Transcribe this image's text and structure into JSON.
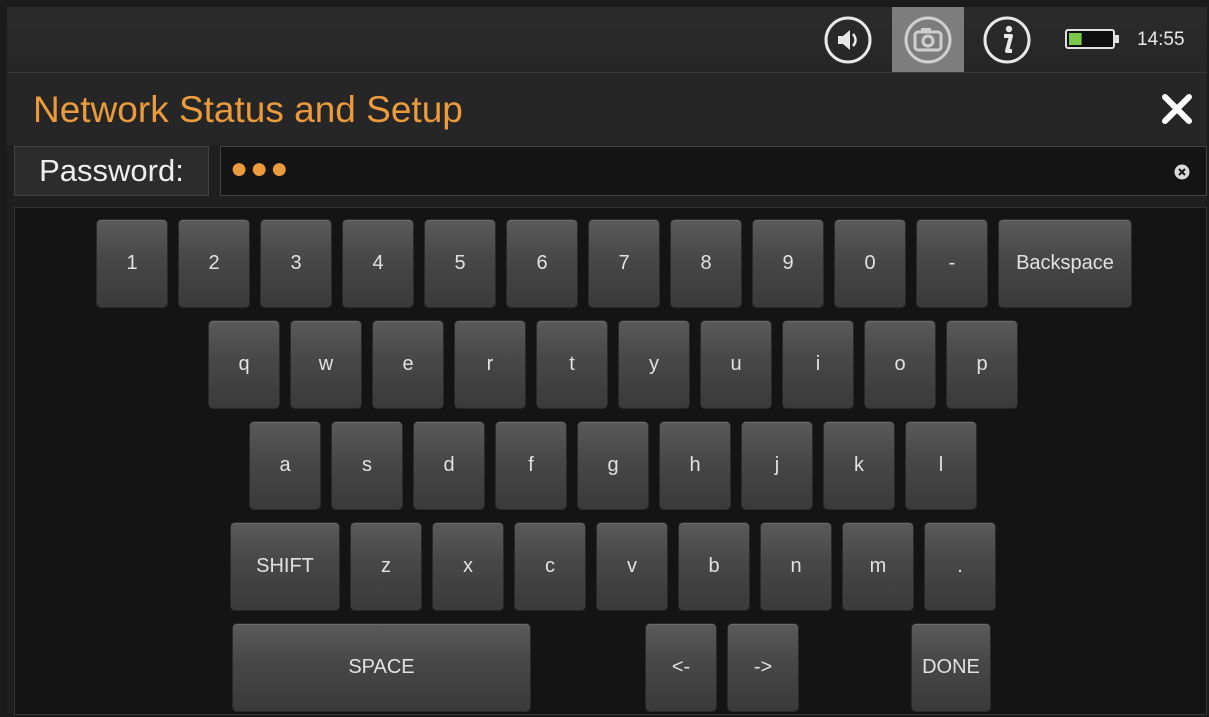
{
  "statusbar": {
    "sound_icon": "speaker-icon",
    "camera_icon": "camera-icon",
    "info_icon": "info-icon",
    "battery_icon": "battery-icon",
    "battery_level": 0.3,
    "time": "14:55"
  },
  "header": {
    "title": "Network Status and Setup",
    "close_icon": "close-icon"
  },
  "password": {
    "label": "Password:",
    "masked_value": "●●●",
    "clear_icon": "clear-icon"
  },
  "keyboard": {
    "row1": [
      "1",
      "2",
      "3",
      "4",
      "5",
      "6",
      "7",
      "8",
      "9",
      "0",
      "-",
      "Backspace"
    ],
    "row2": [
      "q",
      "w",
      "e",
      "r",
      "t",
      "y",
      "u",
      "i",
      "o",
      "p"
    ],
    "row3": [
      "a",
      "s",
      "d",
      "f",
      "g",
      "h",
      "j",
      "k",
      "l"
    ],
    "row4": [
      "SHIFT",
      "z",
      "x",
      "c",
      "v",
      "b",
      "n",
      "m",
      "."
    ],
    "row5": [
      "SPACE",
      "<-",
      "->",
      "DONE"
    ]
  },
  "colors": {
    "accent": "#eb9a3c",
    "battery_fill": "#7cc84a"
  }
}
